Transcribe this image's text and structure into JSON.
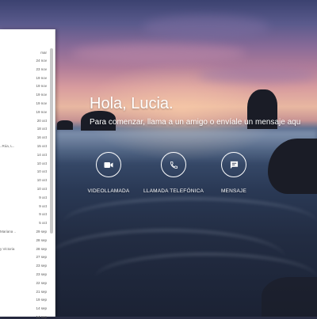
{
  "greeting": {
    "title": "Hola, Lucia.",
    "subtitle": "Para comenzar, llama a un amigo o envíale un mensaje aqu"
  },
  "actions": [
    {
      "label": "VIDEOLLAMADA",
      "icon": "video-camera-icon"
    },
    {
      "label": "LLAMADA TELEFÓNICA",
      "icon": "phone-icon"
    },
    {
      "label": "MENSAJE",
      "icon": "message-icon"
    }
  ],
  "sidebar": {
    "header": "mar",
    "dates": [
      "24 nov",
      "23 nov",
      "19 nov",
      "19 nov",
      "19 nov",
      "19 nov",
      "19 nov",
      "20 oct",
      "18 oct",
      "16 oct",
      "15 oct",
      "14 oct",
      "10 oct",
      "10 oct",
      "10 oct",
      "10 oct",
      "9 oct",
      "9 oct",
      "9 oct",
      "5 oct",
      "29 sep",
      "28 sep",
      "28 sep",
      "27 sep",
      "23 sep",
      "23 sep",
      "22 sep",
      "21 sep",
      "19 sep",
      "14 sep",
      "14 sep"
    ],
    "names": [
      {
        "text": "..Rúa, L..",
        "row": 10
      },
      {
        "text": "Mariana ..",
        "row": 20
      },
      {
        "text": "y Victoria",
        "row": 22
      }
    ]
  },
  "colors": {
    "panel_bg": "#ffffff",
    "text_white": "#ffffff",
    "panel_text": "#555555"
  }
}
